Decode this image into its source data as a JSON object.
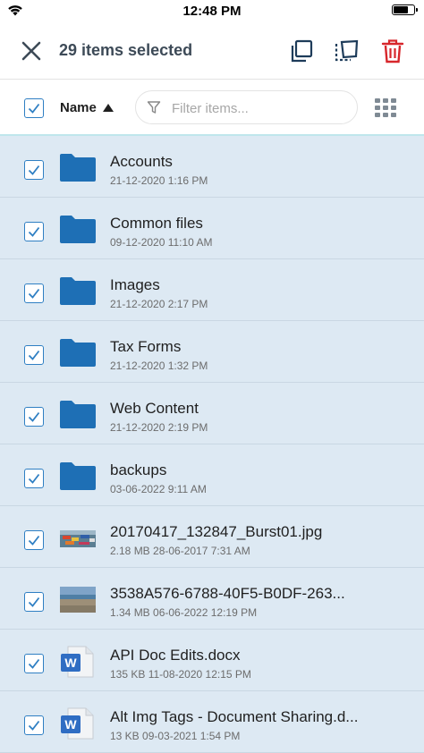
{
  "status_bar": {
    "time": "12:48 PM"
  },
  "action_bar": {
    "selected_count": "29 items selected",
    "icons": [
      "close-icon",
      "copy-icon",
      "move-icon",
      "delete-icon"
    ],
    "delete_color": "#d7262b"
  },
  "toolbar": {
    "sort_label": "Name",
    "sort_direction": "ascending",
    "filter_placeholder": "Filter items..."
  },
  "items": [
    {
      "name": "Accounts",
      "meta": "21-12-2020 1:16 PM",
      "type": "folder",
      "checked": true
    },
    {
      "name": "Common files",
      "meta": "09-12-2020 11:10 AM",
      "type": "folder",
      "checked": true
    },
    {
      "name": "Images",
      "meta": "21-12-2020 2:17 PM",
      "type": "folder",
      "checked": true
    },
    {
      "name": "Tax Forms",
      "meta": "21-12-2020 1:32 PM",
      "type": "folder",
      "checked": true
    },
    {
      "name": "Web Content",
      "meta": "21-12-2020 2:19 PM",
      "type": "folder",
      "checked": true
    },
    {
      "name": "backups",
      "meta": "03-06-2022 9:11 AM",
      "type": "folder",
      "checked": true
    },
    {
      "name": "20170417_132847_Burst01.jpg",
      "meta": "2.18 MB 28-06-2017 7:31 AM",
      "type": "image-thumb-boats",
      "checked": true
    },
    {
      "name": "3538A576-6788-40F5-B0DF-263...",
      "meta": "1.34 MB 06-06-2022 12:19 PM",
      "type": "image-thumb-beach",
      "checked": true
    },
    {
      "name": "API Doc Edits.docx",
      "meta": "135 KB 11-08-2020 12:15 PM",
      "type": "word-doc",
      "checked": true
    },
    {
      "name": "Alt Img Tags - Document Sharing.d...",
      "meta": "13 KB 09-03-2021 1:54 PM",
      "type": "word-doc",
      "checked": true
    }
  ],
  "colors": {
    "accent": "#1e6fb5",
    "list_bg": "#dde9f3",
    "checkbox": "#2f7fc3"
  }
}
